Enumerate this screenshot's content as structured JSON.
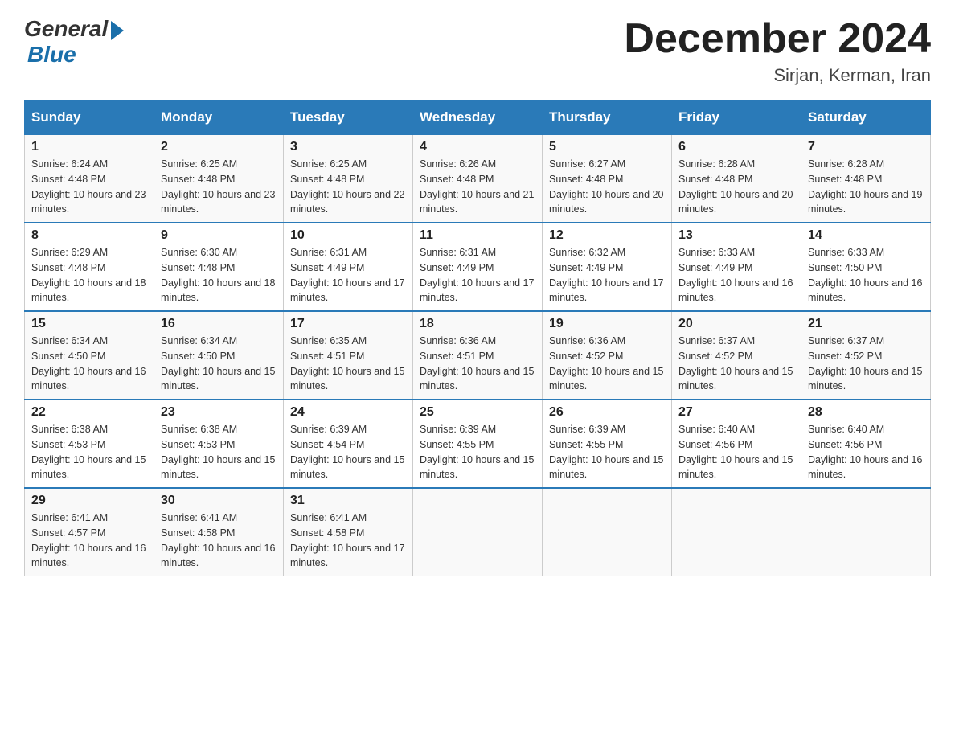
{
  "header": {
    "logo_general": "General",
    "logo_blue": "Blue",
    "month_title": "December 2024",
    "location": "Sirjan, Kerman, Iran"
  },
  "days_of_week": [
    "Sunday",
    "Monday",
    "Tuesday",
    "Wednesday",
    "Thursday",
    "Friday",
    "Saturday"
  ],
  "weeks": [
    [
      {
        "day": "1",
        "sunrise": "6:24 AM",
        "sunset": "4:48 PM",
        "daylight": "10 hours and 23 minutes."
      },
      {
        "day": "2",
        "sunrise": "6:25 AM",
        "sunset": "4:48 PM",
        "daylight": "10 hours and 23 minutes."
      },
      {
        "day": "3",
        "sunrise": "6:25 AM",
        "sunset": "4:48 PM",
        "daylight": "10 hours and 22 minutes."
      },
      {
        "day": "4",
        "sunrise": "6:26 AM",
        "sunset": "4:48 PM",
        "daylight": "10 hours and 21 minutes."
      },
      {
        "day": "5",
        "sunrise": "6:27 AM",
        "sunset": "4:48 PM",
        "daylight": "10 hours and 20 minutes."
      },
      {
        "day": "6",
        "sunrise": "6:28 AM",
        "sunset": "4:48 PM",
        "daylight": "10 hours and 20 minutes."
      },
      {
        "day": "7",
        "sunrise": "6:28 AM",
        "sunset": "4:48 PM",
        "daylight": "10 hours and 19 minutes."
      }
    ],
    [
      {
        "day": "8",
        "sunrise": "6:29 AM",
        "sunset": "4:48 PM",
        "daylight": "10 hours and 18 minutes."
      },
      {
        "day": "9",
        "sunrise": "6:30 AM",
        "sunset": "4:48 PM",
        "daylight": "10 hours and 18 minutes."
      },
      {
        "day": "10",
        "sunrise": "6:31 AM",
        "sunset": "4:49 PM",
        "daylight": "10 hours and 17 minutes."
      },
      {
        "day": "11",
        "sunrise": "6:31 AM",
        "sunset": "4:49 PM",
        "daylight": "10 hours and 17 minutes."
      },
      {
        "day": "12",
        "sunrise": "6:32 AM",
        "sunset": "4:49 PM",
        "daylight": "10 hours and 17 minutes."
      },
      {
        "day": "13",
        "sunrise": "6:33 AM",
        "sunset": "4:49 PM",
        "daylight": "10 hours and 16 minutes."
      },
      {
        "day": "14",
        "sunrise": "6:33 AM",
        "sunset": "4:50 PM",
        "daylight": "10 hours and 16 minutes."
      }
    ],
    [
      {
        "day": "15",
        "sunrise": "6:34 AM",
        "sunset": "4:50 PM",
        "daylight": "10 hours and 16 minutes."
      },
      {
        "day": "16",
        "sunrise": "6:34 AM",
        "sunset": "4:50 PM",
        "daylight": "10 hours and 15 minutes."
      },
      {
        "day": "17",
        "sunrise": "6:35 AM",
        "sunset": "4:51 PM",
        "daylight": "10 hours and 15 minutes."
      },
      {
        "day": "18",
        "sunrise": "6:36 AM",
        "sunset": "4:51 PM",
        "daylight": "10 hours and 15 minutes."
      },
      {
        "day": "19",
        "sunrise": "6:36 AM",
        "sunset": "4:52 PM",
        "daylight": "10 hours and 15 minutes."
      },
      {
        "day": "20",
        "sunrise": "6:37 AM",
        "sunset": "4:52 PM",
        "daylight": "10 hours and 15 minutes."
      },
      {
        "day": "21",
        "sunrise": "6:37 AM",
        "sunset": "4:52 PM",
        "daylight": "10 hours and 15 minutes."
      }
    ],
    [
      {
        "day": "22",
        "sunrise": "6:38 AM",
        "sunset": "4:53 PM",
        "daylight": "10 hours and 15 minutes."
      },
      {
        "day": "23",
        "sunrise": "6:38 AM",
        "sunset": "4:53 PM",
        "daylight": "10 hours and 15 minutes."
      },
      {
        "day": "24",
        "sunrise": "6:39 AM",
        "sunset": "4:54 PM",
        "daylight": "10 hours and 15 minutes."
      },
      {
        "day": "25",
        "sunrise": "6:39 AM",
        "sunset": "4:55 PM",
        "daylight": "10 hours and 15 minutes."
      },
      {
        "day": "26",
        "sunrise": "6:39 AM",
        "sunset": "4:55 PM",
        "daylight": "10 hours and 15 minutes."
      },
      {
        "day": "27",
        "sunrise": "6:40 AM",
        "sunset": "4:56 PM",
        "daylight": "10 hours and 15 minutes."
      },
      {
        "day": "28",
        "sunrise": "6:40 AM",
        "sunset": "4:56 PM",
        "daylight": "10 hours and 16 minutes."
      }
    ],
    [
      {
        "day": "29",
        "sunrise": "6:41 AM",
        "sunset": "4:57 PM",
        "daylight": "10 hours and 16 minutes."
      },
      {
        "day": "30",
        "sunrise": "6:41 AM",
        "sunset": "4:58 PM",
        "daylight": "10 hours and 16 minutes."
      },
      {
        "day": "31",
        "sunrise": "6:41 AM",
        "sunset": "4:58 PM",
        "daylight": "10 hours and 17 minutes."
      },
      null,
      null,
      null,
      null
    ]
  ]
}
